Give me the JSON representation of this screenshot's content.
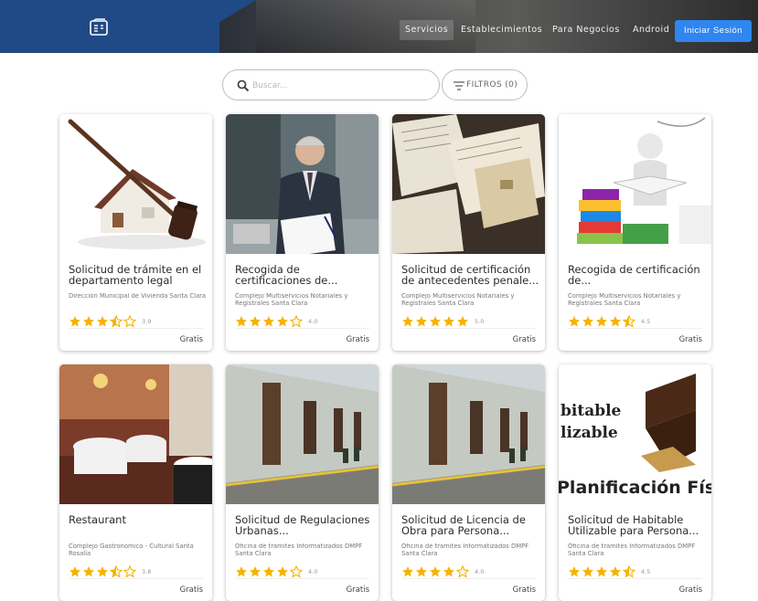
{
  "header": {
    "nav": [
      "Servicios",
      "Establecimientos",
      "Para Negocios",
      "Android"
    ],
    "login": "Iniciar Sesión"
  },
  "search": {
    "placeholder": "Buscar...",
    "value": ""
  },
  "filters": {
    "label": "FILTROS (0)"
  },
  "cards": [
    {
      "title": "Solicitud de trámite en el departamento legal",
      "org": "Dirección Municipal de Vivienda Santa Clara",
      "rating": 3.9,
      "rating_label": "3.9",
      "stars": [
        "full",
        "full",
        "full",
        "half",
        "empty"
      ],
      "price": "Gratis"
    },
    {
      "title": "Recogida de certificaciones de...",
      "org": "Complejo Multiservicios Notariales y Registrales Santa Clara",
      "rating": 4.0,
      "rating_label": "4.0",
      "stars": [
        "full",
        "full",
        "full",
        "full",
        "empty"
      ],
      "price": "Gratis"
    },
    {
      "title": "Solicitud de certificación de antecedentes penale...",
      "org": "Complejo Multiservicios Notariales y Registrales Santa Clara",
      "rating": 5.0,
      "rating_label": "5.0",
      "stars": [
        "full",
        "full",
        "full",
        "full",
        "full"
      ],
      "price": "Gratis"
    },
    {
      "title": "Recogida de certificación de...",
      "org": "Complejo Multiservicios Notariales y Registrales Santa Clara",
      "rating": 4.5,
      "rating_label": "4.5",
      "stars": [
        "full",
        "full",
        "full",
        "full",
        "half"
      ],
      "price": "Gratis"
    },
    {
      "title": "Restaurant",
      "org": "Complejo Gastronómico - Cultural Santa Rosalía",
      "rating": 3.8,
      "rating_label": "3.8",
      "stars": [
        "full",
        "full",
        "full",
        "half",
        "empty"
      ],
      "price": "Gratis"
    },
    {
      "title": "Solicitud de Regulaciones Urbanas...",
      "org": "Oficina de trámites Informatizados DMPF Santa Clara",
      "rating": 4.0,
      "rating_label": "4.0",
      "stars": [
        "full",
        "full",
        "full",
        "full",
        "empty"
      ],
      "price": "Gratis"
    },
    {
      "title": "Solicitud de Licencia de Obra para Persona...",
      "org": "Oficina de trámites Informatizados DMPF Santa Clara",
      "rating": 4.0,
      "rating_label": "4.0",
      "stars": [
        "full",
        "full",
        "full",
        "full",
        "empty"
      ],
      "price": "Gratis"
    },
    {
      "title": "Solicitud de Habitable Utilizable para Persona...",
      "org": "Oficina de trámites Informatizados DMPF Santa Clara",
      "rating": 4.5,
      "rating_label": "4.5",
      "stars": [
        "full",
        "full",
        "full",
        "full",
        "half"
      ],
      "price": "Gratis"
    }
  ],
  "card8_image_text": [
    "bitable",
    "lizable",
    "Planificación Fís"
  ],
  "colors": {
    "header": "#1f4a85",
    "accent": "#2f86f0",
    "star": "#f5b301"
  }
}
